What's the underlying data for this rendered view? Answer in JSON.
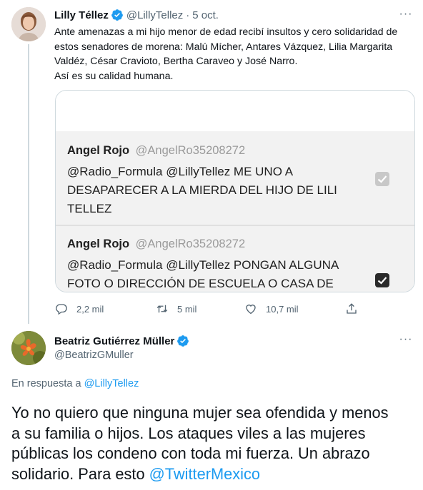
{
  "tweet1": {
    "author_name": "Lilly Téllez",
    "handle": "@LillyTellez",
    "separator": "·",
    "date": "5 oct.",
    "more_label": "···",
    "text_lines": [
      "Ante amenazas a mi hijo menor de edad recibí insultos y cero solidaridad de",
      "estos senadores de morena: Malú Mícher, Antares Vázquez, Lilia Margarita",
      "Valdéz, César Cravioto, Bertha Caraveo y José Narro.",
      "Así es su calidad humana."
    ],
    "media": {
      "replies": [
        {
          "name": "Angel Rojo",
          "handle": "@AngelRo35208272",
          "lines": [
            "@Radio_Formula @LillyTellez ME UNO A",
            "DESAPARECER A LA MIERDA DEL HIJO DE LILI",
            "TELLEZ"
          ],
          "checkbox": "checked-grey"
        },
        {
          "name": "Angel Rojo",
          "handle": "@AngelRo35208272",
          "lines": [
            "@Radio_Formula @LillyTellez PONGAN ALGUNA",
            "FOTO O DIRECCIÓN DE ESCUELA O CASA DE"
          ],
          "checkbox": "checked-dark"
        }
      ]
    },
    "actions": {
      "reply_count": "2,2 mil",
      "retweet_count": "5 mil",
      "like_count": "10,7 mil",
      "reply_icon": "reply-icon",
      "retweet_icon": "retweet-icon",
      "like_icon": "heart-icon",
      "share_icon": "share-icon"
    }
  },
  "tweet2": {
    "author_name": "Beatriz Gutiérrez Müller",
    "handle": "@BeatrizGMuller",
    "more_label": "···",
    "replying_prefix": "En respuesta a",
    "replying_to": "@LillyTellez",
    "text_lines": [
      "Yo no quiero que ninguna mujer sea ofendida y menos",
      "a su familia o hijos. Los ataques viles a las mujeres",
      "públicas los condeno con toda mi fuerza. Un abrazo"
    ],
    "last_line_text": "solidario. Para esto",
    "last_line_mention": "@TwitterMexico"
  },
  "colors": {
    "accent": "#1d9bf0",
    "text_primary": "#0f1419",
    "text_secondary": "#536471",
    "border": "#cfd9de"
  }
}
